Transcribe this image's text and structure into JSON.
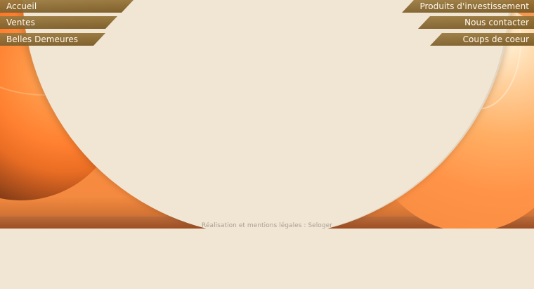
{
  "navigation": {
    "left": [
      {
        "label": "Accueil"
      },
      {
        "label": "Ventes"
      },
      {
        "label": "Belles Demeures"
      }
    ],
    "right": [
      {
        "label": "Produits d'investissement"
      },
      {
        "label": "Nous contacter"
      },
      {
        "label": "Coups de coeur"
      }
    ]
  },
  "footer": {
    "text": "Réalisation et mentions légales : Seloger"
  },
  "colors": {
    "background": "#f1e6d4",
    "accent_orange": "#ff8f45",
    "menu_brown": "#8f6a2f",
    "menu_text": "#fff8ef",
    "footer_text": "#aa9f93"
  }
}
